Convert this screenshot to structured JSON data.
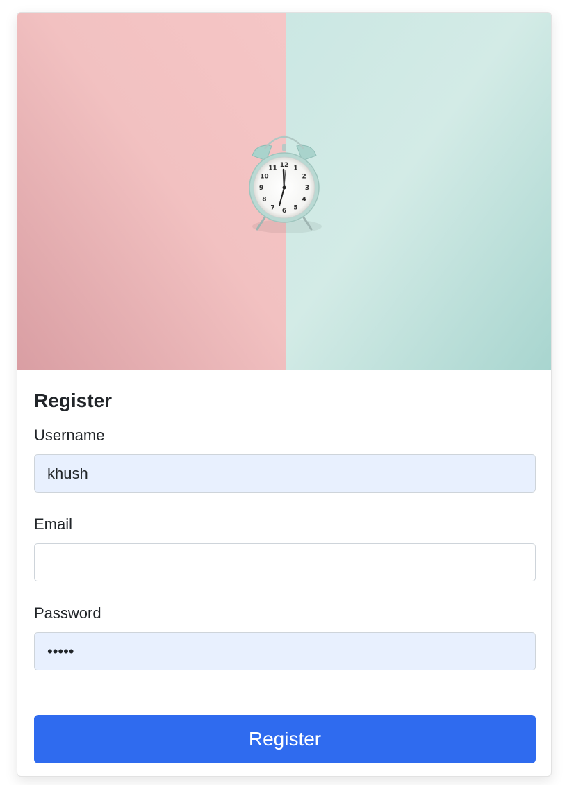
{
  "hero_image": {
    "icon": "alarm-clock-icon",
    "colors": {
      "left": "#f2c1c1",
      "right": "#cbe7e3"
    },
    "clock_numerals": [
      "12",
      "1",
      "2",
      "3",
      "4",
      "5",
      "6",
      "7",
      "8",
      "9",
      "10",
      "11"
    ]
  },
  "form": {
    "title": "Register",
    "fields": {
      "username": {
        "label": "Username",
        "value": "khush",
        "type": "text"
      },
      "email": {
        "label": "Email",
        "value": "",
        "type": "email"
      },
      "password": {
        "label": "Password",
        "value": "abcde",
        "type": "password"
      }
    },
    "submit_label": "Register"
  },
  "colors": {
    "accent": "#2f6bef",
    "autofill_background": "#e8f0fe"
  }
}
